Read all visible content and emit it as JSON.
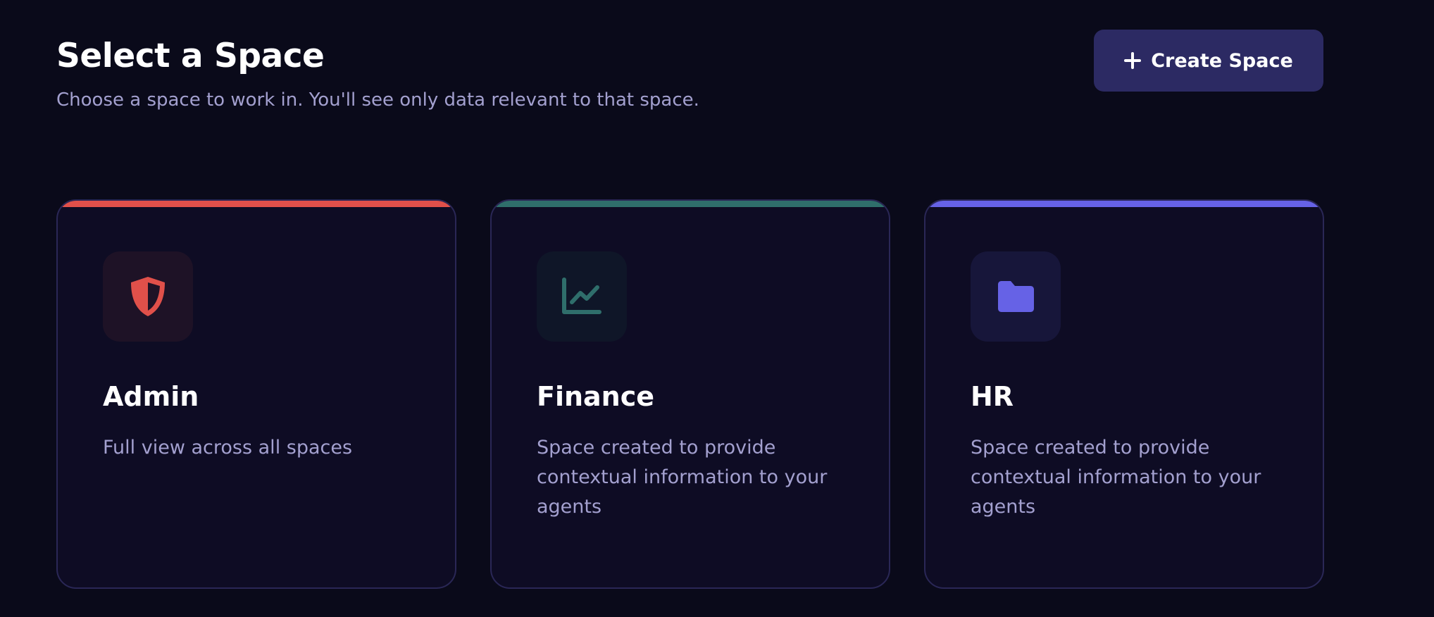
{
  "header": {
    "title": "Select a Space",
    "subtitle": "Choose a space to work in. You'll see only data relevant to that space."
  },
  "toolbar": {
    "create_label": "Create Space",
    "create_icon": "plus-icon"
  },
  "spaces": [
    {
      "name": "Admin",
      "description": "Full view across all spaces",
      "icon": "shield-icon",
      "accent_color": "#e0504a",
      "icon_bg": "#1e1226"
    },
    {
      "name": "Finance",
      "description": "Space created to provide contextual information to your agents",
      "icon": "chart-line-icon",
      "accent_color": "#2f6e6b",
      "icon_bg": "#0f1628"
    },
    {
      "name": "HR",
      "description": "Space created to provide contextual information to your agents",
      "icon": "folder-icon",
      "accent_color": "#6662e6",
      "icon_bg": "#17163a"
    }
  ]
}
